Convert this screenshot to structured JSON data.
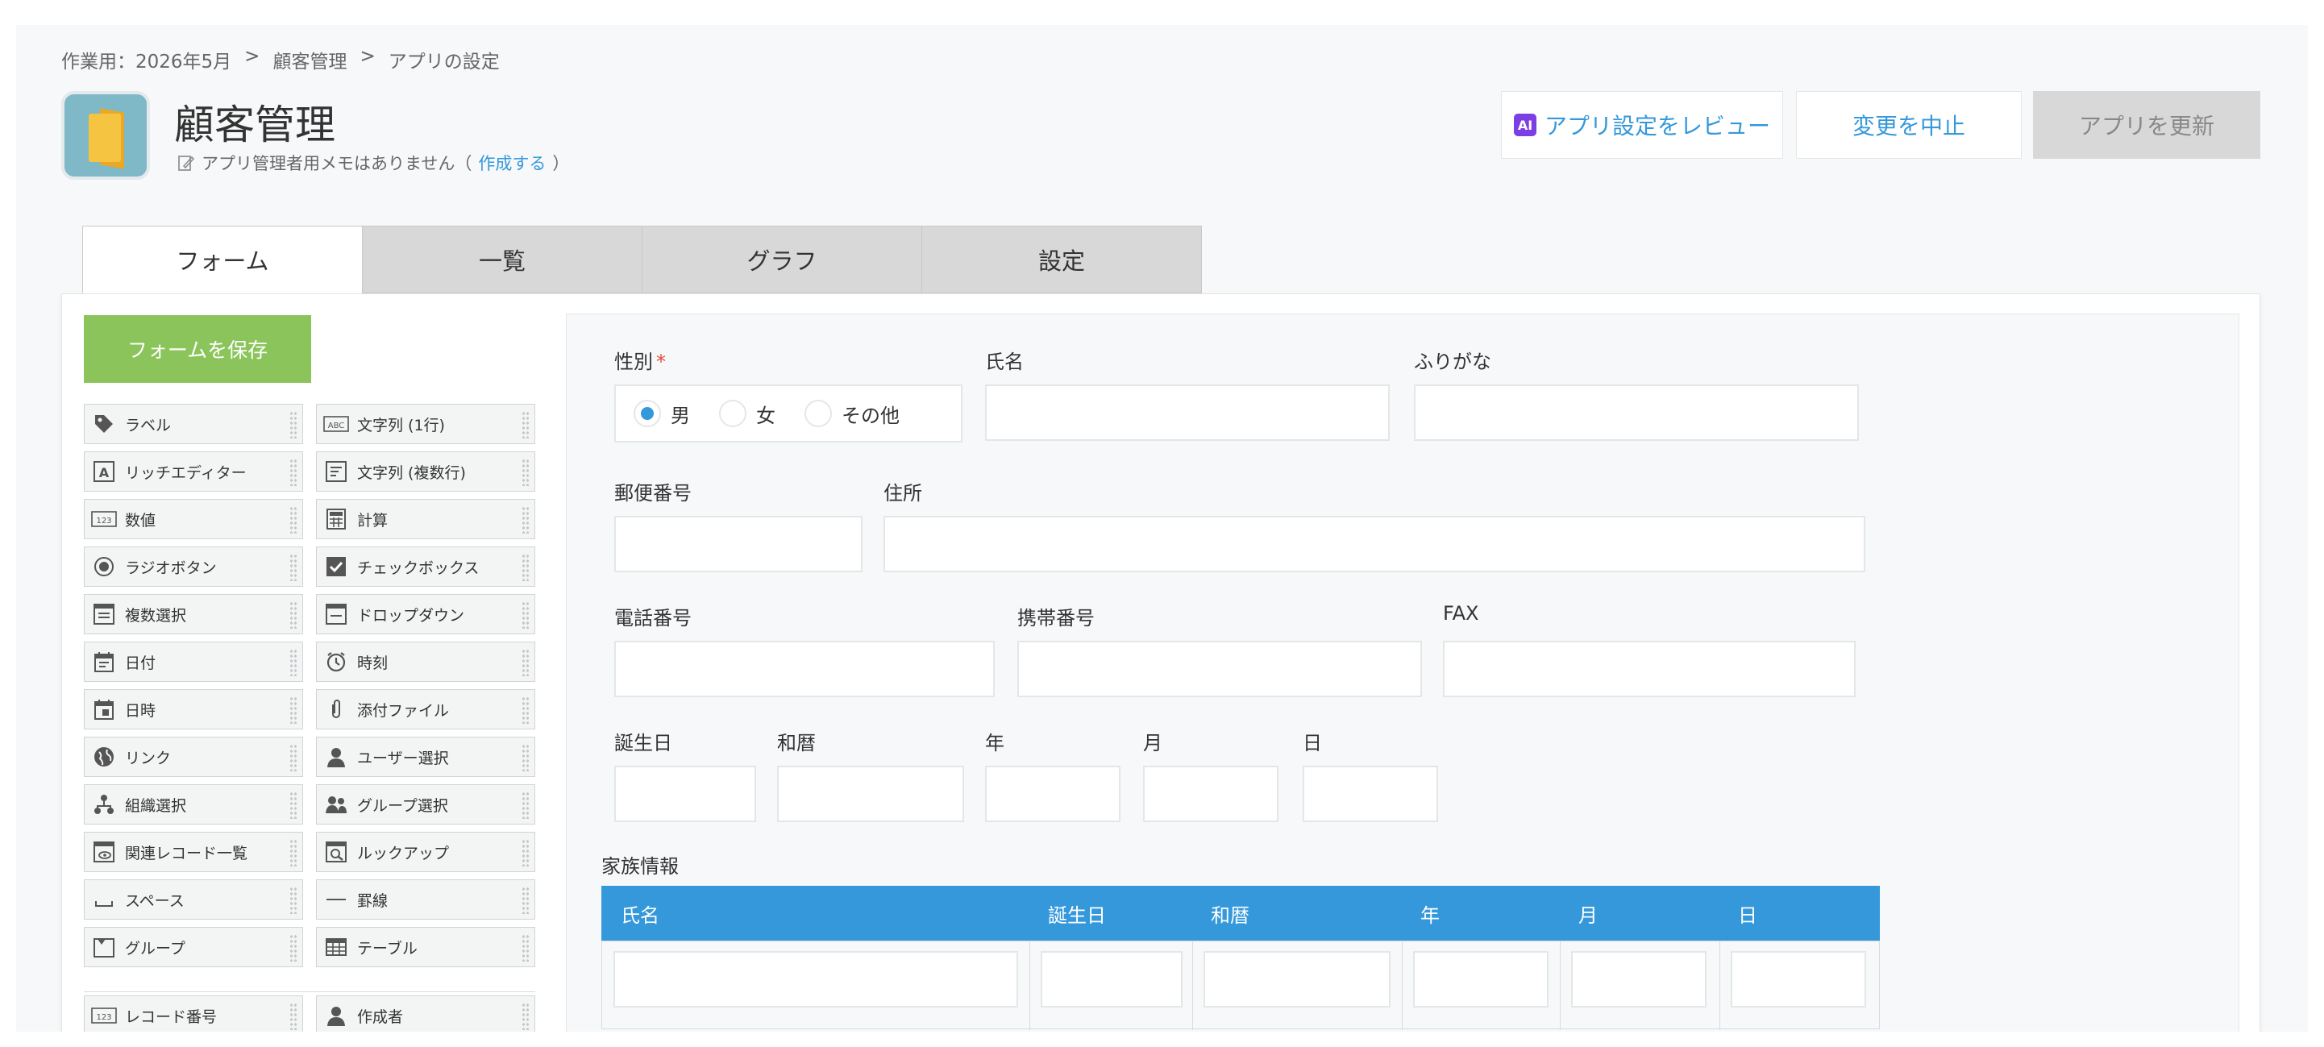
{
  "breadcrumb": [
    "作業用：2026年5月",
    ">",
    "顧客管理",
    ">",
    "アプリの設定"
  ],
  "app": {
    "title": "顧客管理",
    "memo_text": "アプリ管理者用メモはありません（",
    "memo_link": "作成する",
    "memo_end": "）"
  },
  "header_buttons": {
    "review": "アプリ設定をレビュー",
    "review_badge": "AI",
    "cancel": "変更を中止",
    "update": "アプリを更新"
  },
  "tabs": [
    {
      "label": "フォーム",
      "active": true
    },
    {
      "label": "一覧"
    },
    {
      "label": "グラフ"
    },
    {
      "label": "設定"
    }
  ],
  "save_button": "フォームを保存",
  "palette": [
    {
      "label": "ラベル",
      "icon": "tag-icon"
    },
    {
      "label": "文字列 (1行)",
      "icon": "abc-icon"
    },
    {
      "label": "リッチエディター",
      "icon": "rich-editor-icon"
    },
    {
      "label": "文字列 (複数行)",
      "icon": "multiline-icon"
    },
    {
      "label": "数値",
      "icon": "number-icon"
    },
    {
      "label": "計算",
      "icon": "calculator-icon"
    },
    {
      "label": "ラジオボタン",
      "icon": "radio-icon"
    },
    {
      "label": "チェックボックス",
      "icon": "checkbox-icon"
    },
    {
      "label": "複数選択",
      "icon": "multiselect-icon"
    },
    {
      "label": "ドロップダウン",
      "icon": "dropdown-icon"
    },
    {
      "label": "日付",
      "icon": "calendar-icon"
    },
    {
      "label": "時刻",
      "icon": "clock-icon"
    },
    {
      "label": "日時",
      "icon": "calendar-time-icon"
    },
    {
      "label": "添付ファイル",
      "icon": "paperclip-icon"
    },
    {
      "label": "リンク",
      "icon": "globe-icon"
    },
    {
      "label": "ユーザー選択",
      "icon": "user-icon"
    },
    {
      "label": "組織選択",
      "icon": "org-icon"
    },
    {
      "label": "グループ選択",
      "icon": "group-icon"
    },
    {
      "label": "関連レコード一覧",
      "icon": "related-records-icon"
    },
    {
      "label": "ルックアップ",
      "icon": "lookup-icon"
    },
    {
      "label": "スペース",
      "icon": "space-icon"
    },
    {
      "label": "罫線",
      "icon": "line-icon"
    },
    {
      "label": "グループ",
      "icon": "group-folder-icon"
    },
    {
      "label": "テーブル",
      "icon": "table-icon"
    },
    {
      "label": "レコード番号",
      "icon": "record-number-icon"
    },
    {
      "label": "作成者",
      "icon": "creator-icon"
    }
  ],
  "form": {
    "gender": {
      "label": "性別",
      "required_mark": "*",
      "options": [
        "男",
        "女",
        "その他"
      ],
      "selected": "男"
    },
    "name_label": "氏名",
    "furigana_label": "ふりがな",
    "postal_label": "郵便番号",
    "address_label": "住所",
    "phone_label": "電話番号",
    "mobile_label": "携帯番号",
    "fax_label": "FAX",
    "birthday_label": "誕生日",
    "wareki_label": "和暦",
    "year_label": "年",
    "month_label": "月",
    "day_label": "日",
    "family_label": "家族情報",
    "family_table_headers": [
      "氏名",
      "誕生日",
      "和暦",
      "年",
      "月",
      "日"
    ]
  },
  "colors": {
    "accent": "#3498db",
    "save_green": "#8ac45a",
    "required": "#e74c3c",
    "ai_badge": "#7b3fe4"
  }
}
